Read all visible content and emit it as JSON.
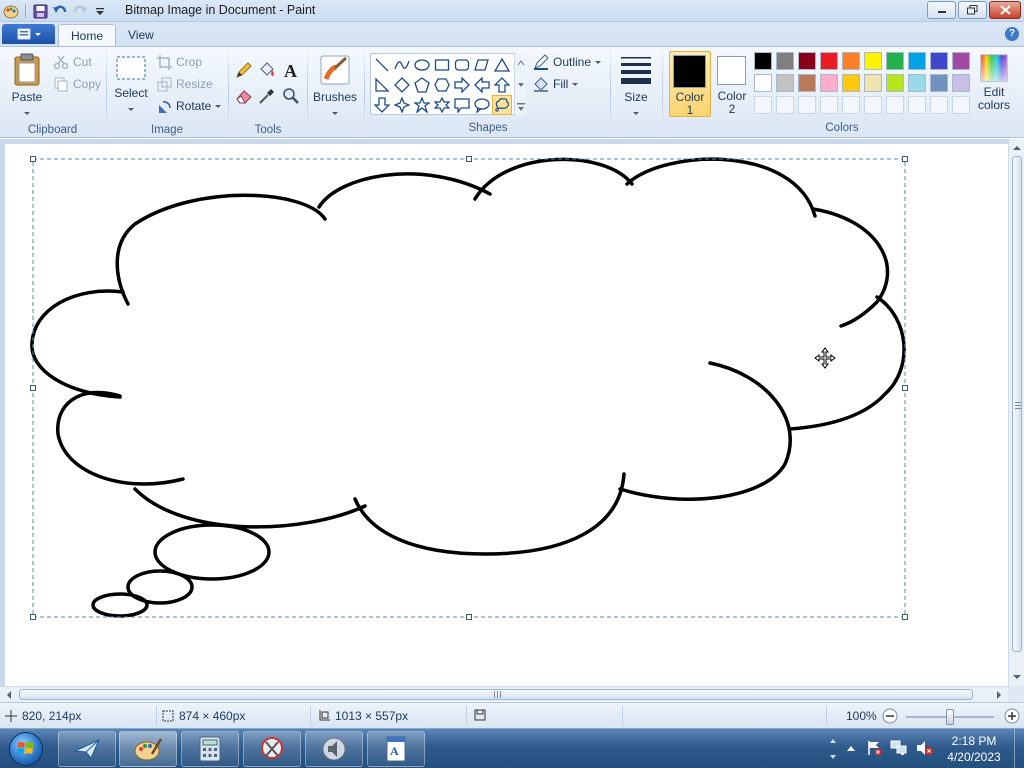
{
  "window": {
    "title": "Bitmap Image in Document - Paint"
  },
  "tabs": [
    {
      "label": "Home",
      "active": true
    },
    {
      "label": "View",
      "active": false
    }
  ],
  "ribbon": {
    "clipboard": {
      "group_label": "Clipboard",
      "paste": "Paste",
      "cut": "Cut",
      "copy": "Copy"
    },
    "image": {
      "group_label": "Image",
      "select": "Select",
      "crop": "Crop",
      "resize": "Resize",
      "rotate": "Rotate"
    },
    "tools": {
      "group_label": "Tools"
    },
    "brushes": {
      "label": "Brushes"
    },
    "shapes": {
      "group_label": "Shapes",
      "outline": "Outline",
      "fill": "Fill",
      "selected_shape": "thought-bubble"
    },
    "size": {
      "label": "Size"
    },
    "color1": {
      "label_line1": "Color",
      "label_line2": "1",
      "value": "#000000"
    },
    "color2": {
      "label_line1": "Color",
      "label_line2": "2",
      "value": "#ffffff"
    },
    "colors": {
      "group_label": "Colors",
      "edit_line1": "Edit",
      "edit_line2": "colors",
      "palette_row1": [
        "#000000",
        "#7f7f7f",
        "#880015",
        "#ed1c24",
        "#ff7f27",
        "#fff200",
        "#22b14c",
        "#00a2e8",
        "#3f48cc",
        "#a349a4"
      ],
      "palette_row2": [
        "#ffffff",
        "#c3c3c3",
        "#b97a57",
        "#ffaec9",
        "#ffc90e",
        "#efe4b0",
        "#b5e61d",
        "#99d9ea",
        "#7092be",
        "#c8bfe7"
      ]
    }
  },
  "status": {
    "cursor_pos": "820, 214px",
    "selection_size": "874 × 460px",
    "image_size": "1013 × 557px",
    "zoom": "100%"
  },
  "taskbar": {
    "time": "2:18 PM",
    "date": "4/20/2023"
  }
}
